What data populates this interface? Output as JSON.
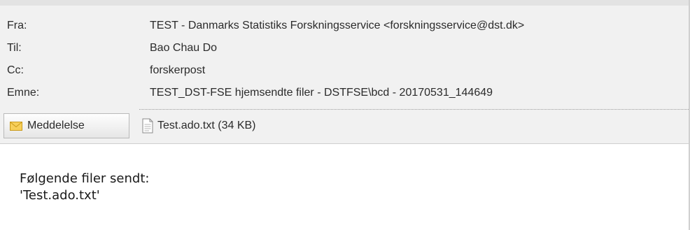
{
  "header": {
    "rows": [
      {
        "label": "Fra:",
        "value": "TEST - Danmarks Statistiks Forskningsservice <forskningsservice@dst.dk>"
      },
      {
        "label": "Til:",
        "value": "Bao Chau Do"
      },
      {
        "label": "Cc:",
        "value": "forskerpost"
      },
      {
        "label": "Emne:",
        "value": "TEST_DST-FSE hjemsendte filer - DSTFSE\\bcd - 20170531_144649"
      }
    ]
  },
  "tabs": {
    "message_label": "Meddelelse",
    "message_icon": "envelope-icon",
    "attachment_label": "Test.ado.txt (34 KB)",
    "attachment_icon": "text-document-icon"
  },
  "body": {
    "lines": [
      "Følgende filer sendt:",
      "'Test.ado.txt'"
    ]
  },
  "colors": {
    "header_bg": "#f1f1f1",
    "envelope": "#f5c542"
  }
}
